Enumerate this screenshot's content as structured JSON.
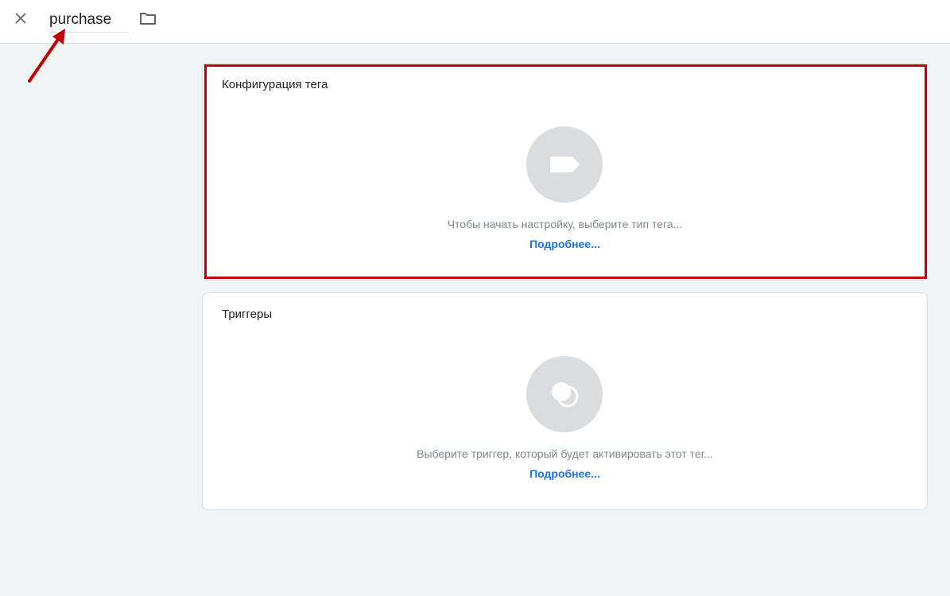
{
  "header": {
    "tag_name": "purchase",
    "close_icon": "close-icon",
    "folder_icon": "folder-icon"
  },
  "tag_config": {
    "title": "Конфигурация тега",
    "hint": "Чтобы начать настройку, выберите тип тега...",
    "more_link": "Подробнее...",
    "icon": "tag-icon"
  },
  "triggers": {
    "title": "Триггеры",
    "hint": "Выберите триггер, который будет активировать этот тег...",
    "more_link": "Подробнее...",
    "icon": "trigger-icon"
  },
  "colors": {
    "background": "#f1f3f4",
    "highlight": "#c00000",
    "link": "#1a73e8",
    "icon_circle": "#dadce0"
  }
}
